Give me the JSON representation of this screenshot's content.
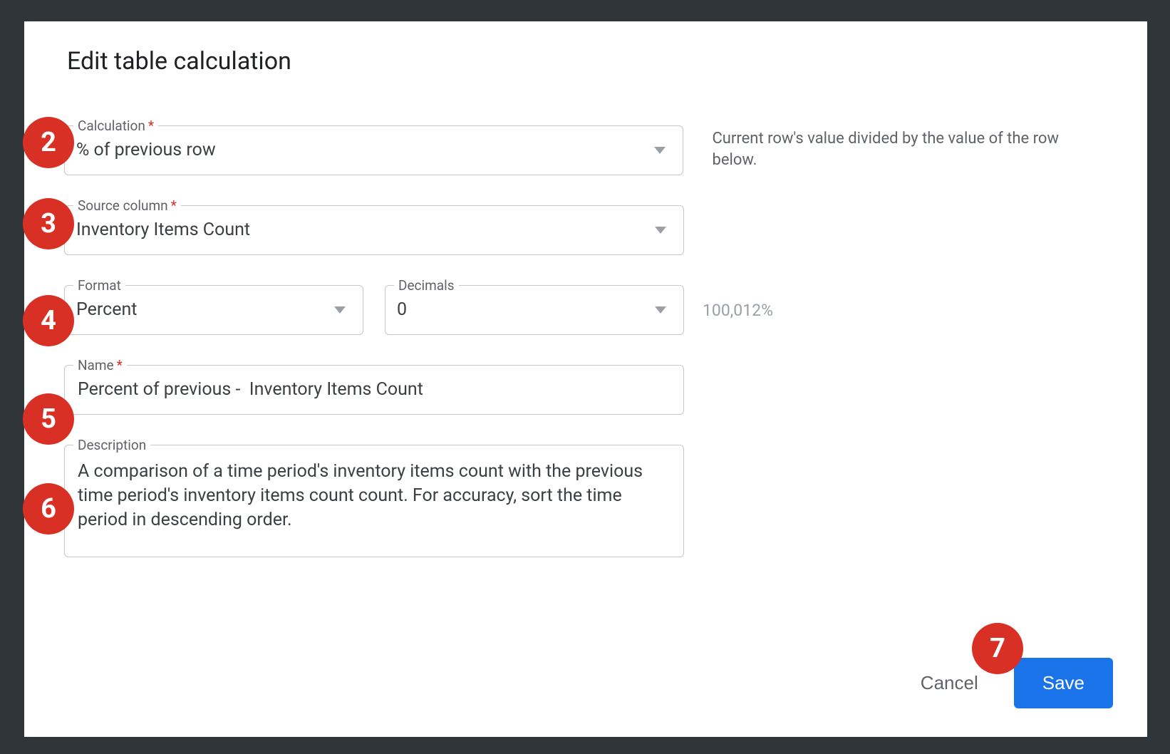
{
  "title": "Edit table calculation",
  "calculation": {
    "label": "Calculation",
    "required": "*",
    "value": "% of previous row",
    "help": "Current row's value divided by the value of the row below."
  },
  "source": {
    "label": "Source column",
    "required": "*",
    "value": "Inventory Items Count"
  },
  "format": {
    "label": "Format",
    "value": "Percent"
  },
  "decimals": {
    "label": "Decimals",
    "value": "0"
  },
  "format_preview": "100,012%",
  "name": {
    "label": "Name",
    "required": "*",
    "value": "Percent of previous -  Inventory Items Count"
  },
  "description": {
    "label": "Description",
    "value": "A comparison of a time period's inventory items count with the previous time period's inventory items count count. For accuracy, sort the time period in descending order."
  },
  "buttons": {
    "cancel": "Cancel",
    "save": "Save"
  },
  "badges": {
    "b2": "2",
    "b3": "3",
    "b4": "4",
    "b5": "5",
    "b6": "6",
    "b7": "7"
  }
}
